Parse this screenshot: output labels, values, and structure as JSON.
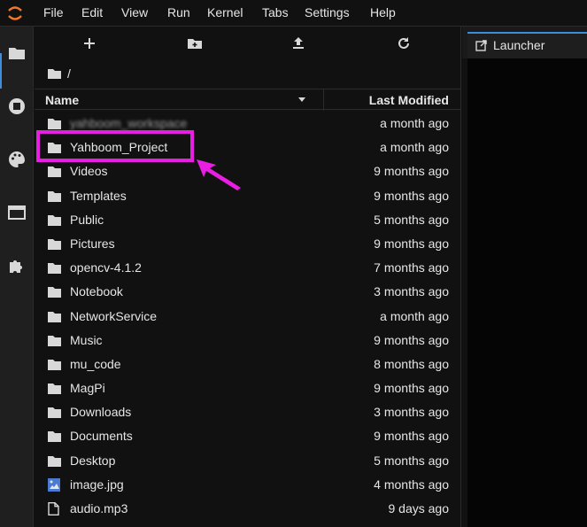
{
  "menubar": {
    "items": [
      "File",
      "Edit",
      "View",
      "Run",
      "Kernel",
      "Tabs",
      "Settings",
      "Help"
    ]
  },
  "activity": {
    "icons": [
      "folder-icon",
      "running-icon",
      "palette-icon",
      "tabs-icon",
      "extension-icon"
    ]
  },
  "toolbar": {
    "buttons": [
      "new-launcher",
      "new-folder",
      "upload",
      "refresh"
    ]
  },
  "breadcrumb": {
    "path": "/"
  },
  "file_list": {
    "column_name": "Name",
    "column_modified": "Last Modified",
    "rows": [
      {
        "name": "yahboom_workspace",
        "modified": "a month ago",
        "icon": "folder-icon",
        "obscured": true
      },
      {
        "name": "Yahboom_Project",
        "modified": "a month ago",
        "icon": "folder-icon"
      },
      {
        "name": "Videos",
        "modified": "9 months ago",
        "icon": "folder-icon"
      },
      {
        "name": "Templates",
        "modified": "9 months ago",
        "icon": "folder-icon"
      },
      {
        "name": "Public",
        "modified": "5 months ago",
        "icon": "folder-icon"
      },
      {
        "name": "Pictures",
        "modified": "9 months ago",
        "icon": "folder-icon"
      },
      {
        "name": "opencv-4.1.2",
        "modified": "7 months ago",
        "icon": "folder-icon"
      },
      {
        "name": "Notebook",
        "modified": "3 months ago",
        "icon": "folder-icon"
      },
      {
        "name": "NetworkService",
        "modified": "a month ago",
        "icon": "folder-icon"
      },
      {
        "name": "Music",
        "modified": "9 months ago",
        "icon": "folder-icon"
      },
      {
        "name": "mu_code",
        "modified": "8 months ago",
        "icon": "folder-icon"
      },
      {
        "name": "MagPi",
        "modified": "9 months ago",
        "icon": "folder-icon"
      },
      {
        "name": "Downloads",
        "modified": "3 months ago",
        "icon": "folder-icon"
      },
      {
        "name": "Documents",
        "modified": "9 months ago",
        "icon": "folder-icon"
      },
      {
        "name": "Desktop",
        "modified": "5 months ago",
        "icon": "folder-icon"
      },
      {
        "name": "image.jpg",
        "modified": "4 months ago",
        "icon": "image-file-icon"
      },
      {
        "name": "audio.mp3",
        "modified": "9 days ago",
        "icon": "file-icon"
      }
    ]
  },
  "main": {
    "tab_label": "Launcher"
  },
  "colors": {
    "highlight": "#e91ee3",
    "accent": "#3c8dde",
    "background": "#111111"
  }
}
